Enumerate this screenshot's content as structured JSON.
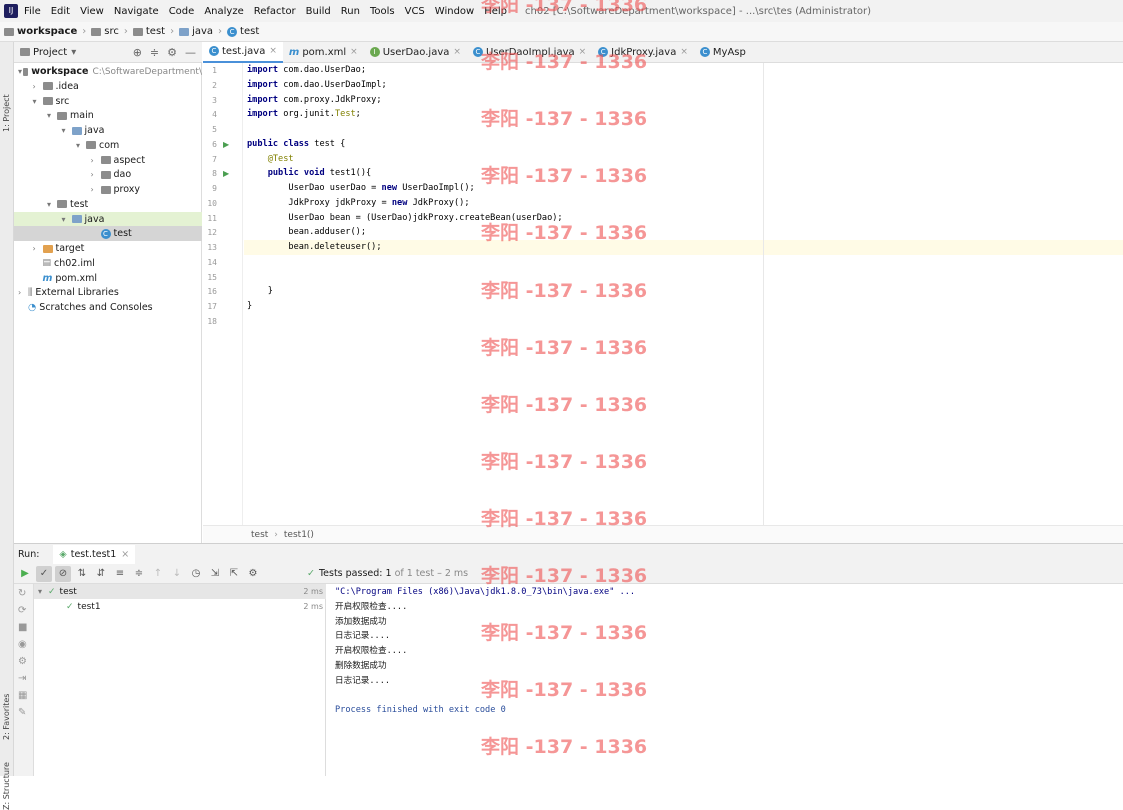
{
  "menubar": {
    "items": [
      "File",
      "Edit",
      "View",
      "Navigate",
      "Code",
      "Analyze",
      "Refactor",
      "Build",
      "Run",
      "Tools",
      "VCS",
      "Window",
      "Help"
    ],
    "window_title": "ch02 [C:\\SoftwareDepartment\\workspace] - ...\\src\\tes (Administrator)"
  },
  "breadcrumb": [
    "workspace",
    "src",
    "test",
    "java",
    "test"
  ],
  "left_strip": {
    "project_label": "1: Project",
    "favorites_label": "2: Favorites",
    "structure_label": "Z: Structure"
  },
  "project": {
    "header": "Project",
    "tree": [
      {
        "label": "workspace",
        "suffix": "C:\\SoftwareDepartment\\",
        "depth": 0,
        "arrow": "v",
        "icon": "folder"
      },
      {
        "label": ".idea",
        "depth": 1,
        "arrow": ">",
        "icon": "folder"
      },
      {
        "label": "src",
        "depth": 1,
        "arrow": "v",
        "icon": "folder"
      },
      {
        "label": "main",
        "depth": 2,
        "arrow": "v",
        "icon": "folder"
      },
      {
        "label": "java",
        "depth": 3,
        "arrow": "v",
        "icon": "folder-blue"
      },
      {
        "label": "com",
        "depth": 4,
        "arrow": "v",
        "icon": "folder"
      },
      {
        "label": "aspect",
        "depth": 5,
        "arrow": ">",
        "icon": "folder"
      },
      {
        "label": "dao",
        "depth": 5,
        "arrow": ">",
        "icon": "folder"
      },
      {
        "label": "proxy",
        "depth": 5,
        "arrow": ">",
        "icon": "folder"
      },
      {
        "label": "test",
        "depth": 2,
        "arrow": "v",
        "icon": "folder"
      },
      {
        "label": "java",
        "depth": 3,
        "arrow": "v",
        "icon": "folder-blue",
        "state": "hl"
      },
      {
        "label": "test",
        "depth": 5,
        "arrow": "",
        "icon": "class",
        "state": "sel"
      },
      {
        "label": "target",
        "depth": 1,
        "arrow": ">",
        "icon": "folder-orange"
      },
      {
        "label": "ch02.iml",
        "depth": 1,
        "arrow": "",
        "icon": "file"
      },
      {
        "label": "pom.xml",
        "depth": 1,
        "arrow": "",
        "icon": "m"
      },
      {
        "label": "External Libraries",
        "depth": 0,
        "arrow": ">",
        "icon": "lib"
      },
      {
        "label": "Scratches and Consoles",
        "depth": 0,
        "arrow": "",
        "icon": "scratch"
      }
    ]
  },
  "tabs": [
    {
      "label": "test.java",
      "icon": "class",
      "active": true
    },
    {
      "label": "pom.xml",
      "icon": "m"
    },
    {
      "label": "UserDao.java",
      "icon": "iface"
    },
    {
      "label": "UserDaoImpl.java",
      "icon": "class"
    },
    {
      "label": "JdkProxy.java",
      "icon": "class"
    },
    {
      "label": "MyAsp",
      "icon": "class"
    }
  ],
  "editor": {
    "lines": [
      [
        {
          "t": "import ",
          "c": "kw"
        },
        {
          "t": "com.dao.UserDao;"
        }
      ],
      [
        {
          "t": "import ",
          "c": "kw"
        },
        {
          "t": "com.dao.UserDaoImpl;"
        }
      ],
      [
        {
          "t": "import ",
          "c": "kw"
        },
        {
          "t": "com.proxy.JdkProxy;"
        }
      ],
      [
        {
          "t": "import ",
          "c": "kw"
        },
        {
          "t": "org.junit."
        },
        {
          "t": "Test",
          "c": "an"
        },
        {
          "t": ";"
        }
      ],
      [],
      [
        {
          "t": "public class ",
          "c": "kw"
        },
        {
          "t": "test {"
        }
      ],
      [
        {
          "t": "    "
        },
        {
          "t": "@Test",
          "c": "an"
        }
      ],
      [
        {
          "t": "    "
        },
        {
          "t": "public void ",
          "c": "kw"
        },
        {
          "t": "test1(){"
        }
      ],
      [
        {
          "t": "        UserDao userDao = "
        },
        {
          "t": "new ",
          "c": "kw"
        },
        {
          "t": "UserDaoImpl();"
        }
      ],
      [
        {
          "t": "        JdkProxy jdkProxy = "
        },
        {
          "t": "new ",
          "c": "kw"
        },
        {
          "t": "JdkProxy();"
        }
      ],
      [
        {
          "t": "        UserDao bean = (UserDao)jdkProxy.createBean(userDao);"
        }
      ],
      [
        {
          "t": "        bean.adduser();"
        }
      ],
      [
        {
          "t": "        bean.deleteuser();"
        }
      ],
      [],
      [],
      [
        {
          "t": "    }"
        }
      ],
      [
        {
          "t": "}"
        }
      ],
      []
    ],
    "line_numbers": [
      "1",
      "2",
      "3",
      "4",
      "5",
      "6",
      "7",
      "8",
      "9",
      "10",
      "11",
      "12",
      "13",
      "14",
      "15",
      "16",
      "17",
      "18"
    ],
    "footer": [
      "test",
      "test1()"
    ]
  },
  "run": {
    "label": "Run:",
    "tab": "test.test1",
    "status_prefix": "Tests passed:",
    "status_count": "1",
    "status_suffix": "of 1 test – 2 ms",
    "tree": [
      {
        "label": "test",
        "duration": "2 ms",
        "depth": 0
      },
      {
        "label": "test1",
        "duration": "2 ms",
        "depth": 1
      }
    ],
    "console": [
      {
        "text": "\"C:\\Program Files (x86)\\Java\\jdk1.8.0_73\\bin\\java.exe\" ...",
        "kind": "path"
      },
      {
        "text": "开启权限检查....",
        "kind": "out"
      },
      {
        "text": "添加数据成功",
        "kind": "out"
      },
      {
        "text": "日志记录....",
        "kind": "out"
      },
      {
        "text": "开启权限检查....",
        "kind": "out"
      },
      {
        "text": "删除数据成功",
        "kind": "out"
      },
      {
        "text": "日志记录....",
        "kind": "out"
      },
      {
        "text": "",
        "kind": "out"
      },
      {
        "text": "Process finished with exit code 0",
        "kind": "exit"
      }
    ]
  },
  "watermark": "李阳 -137 - 1336"
}
